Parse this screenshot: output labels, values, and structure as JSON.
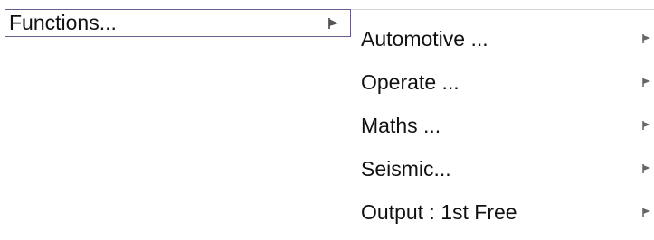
{
  "menu": {
    "parent_label": "Functions...",
    "parent_arrow_icon": "submenu-arrow-icon",
    "border_color": "#6b5a8c"
  },
  "submenu": {
    "items": [
      {
        "label": "Automotive ...",
        "icon": "submenu-arrow-icon"
      },
      {
        "label": "Operate ...",
        "icon": "submenu-arrow-icon"
      },
      {
        "label": "Maths ...",
        "icon": "submenu-arrow-icon"
      },
      {
        "label": "Seismic...",
        "icon": "submenu-arrow-icon"
      },
      {
        "label": "Output : 1st Free",
        "icon": "submenu-arrow-icon"
      }
    ]
  }
}
